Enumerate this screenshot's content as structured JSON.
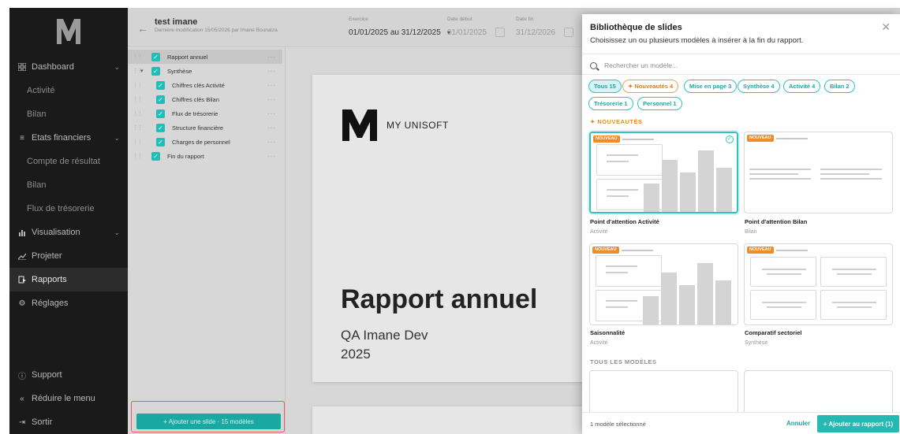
{
  "sidebar": {
    "items": [
      {
        "label": "Dashboard",
        "icon": "grid-icon"
      },
      {
        "label": "Activité"
      },
      {
        "label": "Bilan"
      },
      {
        "label": "Etats financiers",
        "icon": "menu-icon"
      },
      {
        "label": "Compte de résultat"
      },
      {
        "label": "Bilan"
      },
      {
        "label": "Flux de trésorerie"
      },
      {
        "label": "Visualisation",
        "icon": "chart-icon"
      },
      {
        "label": "Projeter",
        "icon": "trend-icon"
      },
      {
        "label": "Rapports",
        "icon": "report-icon"
      },
      {
        "label": "Réglages",
        "icon": "gear-icon"
      }
    ],
    "bottom": {
      "support": "Support",
      "reduce": "Réduire le menu",
      "logout": "Sortir"
    }
  },
  "header": {
    "report_title": "test imane",
    "report_meta": "Dernière modification 15/05/2026 par Imane Bounaiza",
    "exercise_label": "Exercice",
    "exercise_value": "01/01/2025 au 31/12/2025",
    "start_label": "Date début",
    "start_value": "01/01/2025",
    "end_label": "Date fin",
    "end_value": "31/12/2026"
  },
  "tree": {
    "items": [
      {
        "label": "Rapport annuel"
      },
      {
        "label": "Synthèse"
      },
      {
        "label": "Chiffres clés Activité"
      },
      {
        "label": "Chiffres clés Bilan"
      },
      {
        "label": "Flux de trésorerie"
      },
      {
        "label": "Structure financière"
      },
      {
        "label": "Charges de personnel"
      },
      {
        "label": "Fin du rapport"
      }
    ],
    "add_button": "+   Ajouter une slide · 15 modèles"
  },
  "slide": {
    "brand": "MY UNISOFT",
    "title": "Rapport annuel",
    "subtitle": "QA Imane Dev",
    "year": "2025"
  },
  "modal": {
    "title": "Bibliothèque de slides",
    "subtitle": "Choisissez un ou plusieurs modèles à insérer à la fin du rapport.",
    "search_placeholder": "Rechercher un modèle...",
    "chips": [
      {
        "label": "Tous 15"
      },
      {
        "label": "✦ Nouveautés 4"
      },
      {
        "label": "Mise en page 3"
      },
      {
        "label": "Synthèse 4"
      },
      {
        "label": "Activité 4"
      },
      {
        "label": "Bilan 2"
      },
      {
        "label": "Trésorerie 1"
      },
      {
        "label": "Personnel 1"
      }
    ],
    "section_new": "✦ NOUVEAUTÉS",
    "section_all": "TOUS LES MODÈLES",
    "badge": "NOUVEAU",
    "cards": [
      {
        "name": "Point d'attention Activité",
        "category": "Activité"
      },
      {
        "name": "Point d'attention Bilan",
        "category": "Bilan"
      },
      {
        "name": "Saisonnalité",
        "category": "Activité"
      },
      {
        "name": "Comparatif sectoriel",
        "category": "Synthèse"
      }
    ],
    "footer": {
      "count": "1 modèle sélectionné",
      "cancel": "Annuler",
      "add": "+ Ajouter au rapport (1)"
    }
  },
  "colors": {
    "accent": "#26b8b2",
    "accent_light": "#d9f3f2",
    "orange": "#f08c2a",
    "sidebar_bg": "#1a1a1a"
  }
}
